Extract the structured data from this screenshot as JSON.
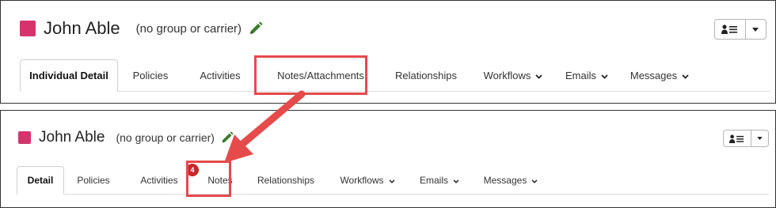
{
  "colors": {
    "swatch": "#d6336c",
    "highlight": "#e54b4b",
    "badge": "#c62828",
    "pencil": "#3b7a2a"
  },
  "top": {
    "name": "John Able",
    "subtitle": "(no group or carrier)",
    "edit_icon": "pencil-icon",
    "user_button_icon": "user-list-icon",
    "tabs": [
      {
        "label": "Individual Detail",
        "active": true
      },
      {
        "label": "Policies"
      },
      {
        "label": "Activities"
      },
      {
        "label": "Notes/Attachments",
        "highlighted": true
      },
      {
        "label": "Relationships"
      },
      {
        "label": "Workflows",
        "dropdown": true
      },
      {
        "label": "Emails",
        "dropdown": true
      },
      {
        "label": "Messages",
        "dropdown": true
      }
    ]
  },
  "bottom": {
    "name": "John Able",
    "subtitle": "(no group or carrier)",
    "edit_icon": "pencil-icon",
    "user_button_icon": "user-list-icon",
    "activities_badge": "4",
    "tabs": [
      {
        "label": "Detail",
        "active": true
      },
      {
        "label": "Policies"
      },
      {
        "label": "Activities"
      },
      {
        "label": "Notes",
        "highlighted": true
      },
      {
        "label": "Relationships"
      },
      {
        "label": "Workflows",
        "dropdown": true
      },
      {
        "label": "Emails",
        "dropdown": true
      },
      {
        "label": "Messages",
        "dropdown": true
      }
    ]
  }
}
